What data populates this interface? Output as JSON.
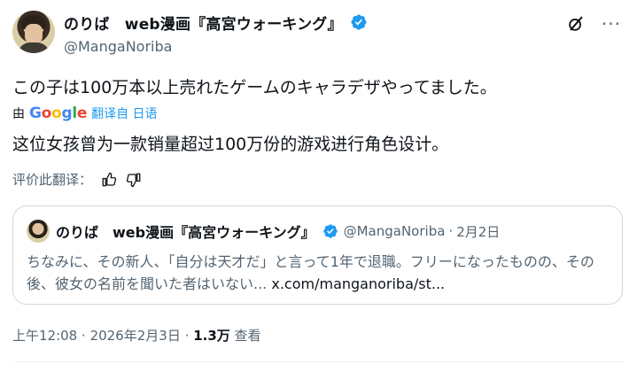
{
  "author": {
    "name": "のりば　web漫画『高宮ウォーキング』",
    "handle": "@MangaNoriba"
  },
  "tweet": {
    "text": "この子は100万本以上売れたゲームのキャラデザやってました。"
  },
  "translation_bar": {
    "prefix": "由",
    "google": [
      "G",
      "o",
      "o",
      "g",
      "l",
      "e"
    ],
    "action": "翻译自 日语",
    "translated_text": "这位女孩曾为一款销量超过100万份的游戏进行角色设计。",
    "rate_label": "评价此翻译："
  },
  "quote": {
    "name": "のりば　web漫画『高宮ウォーキング』",
    "handle": "@MangaNoriba",
    "separator": "·",
    "date": "2月2日",
    "text": "ちなみに、その新人、「自分は天才だ」と言って1年で退職。フリーになったものの、その後、彼女の名前を聞いた者はいない...",
    "link": "x.com/manganoriba/st..."
  },
  "meta": {
    "time": "上午12:08",
    "date": "2026年2月3日",
    "views_count": "1.3万",
    "views_label": "查看",
    "separator": "·"
  },
  "colors": {
    "verified": "#1d9bf0",
    "link": "#1d9bf0",
    "secondary_text": "#536471"
  },
  "icons": [
    "verified-badge-icon",
    "grok-icon",
    "more-icon",
    "thumbs-up-icon",
    "thumbs-down-icon"
  ]
}
